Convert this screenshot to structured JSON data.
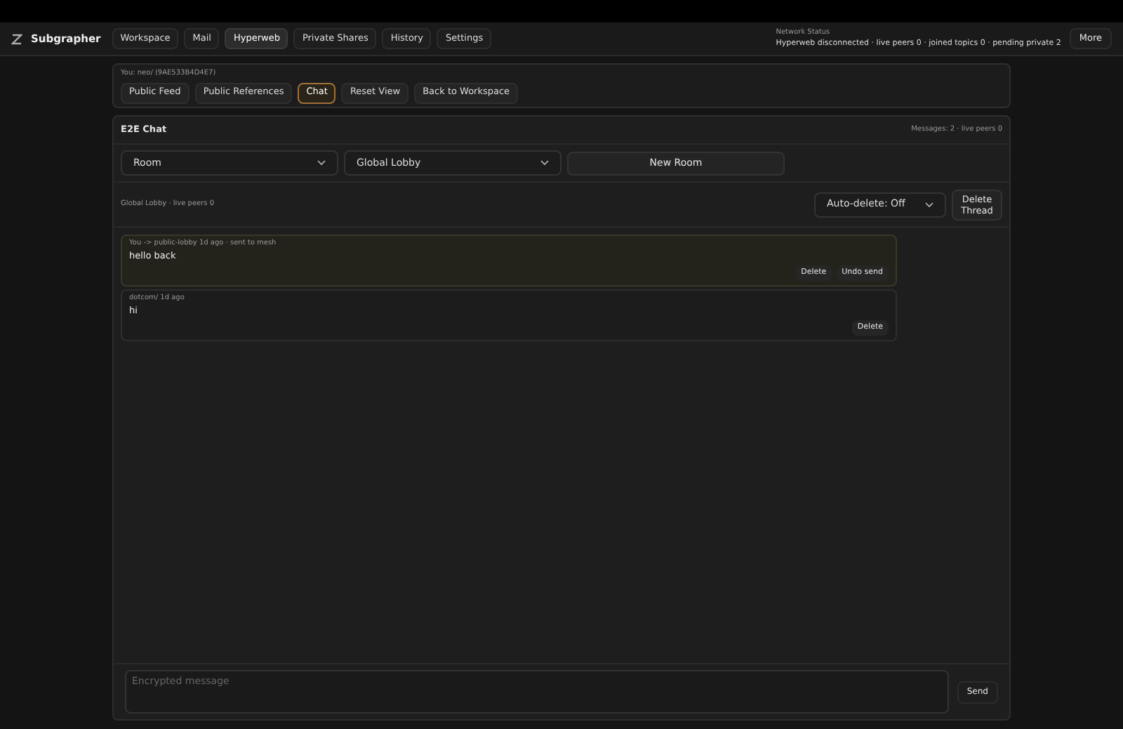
{
  "app": {
    "name": "Subgrapher"
  },
  "nav": [
    {
      "label": "Workspace",
      "selected": false
    },
    {
      "label": "Mail",
      "selected": false
    },
    {
      "label": "Hyperweb",
      "selected": true
    },
    {
      "label": "Private Shares",
      "selected": false
    },
    {
      "label": "History",
      "selected": false
    },
    {
      "label": "Settings",
      "selected": false
    }
  ],
  "network_status": {
    "label": "Network Status",
    "text": "Hyperweb disconnected · live peers 0 · joined topics 0 · pending private 2"
  },
  "more_button": "More",
  "identity": "You: neo/ (9AE533B4D4E7)",
  "tabs": [
    {
      "label": "Public Feed",
      "selected": false
    },
    {
      "label": "Public References",
      "selected": false
    },
    {
      "label": "Chat",
      "selected": true
    },
    {
      "label": "Reset View",
      "selected": false
    },
    {
      "label": "Back to Workspace",
      "selected": false
    }
  ],
  "chat": {
    "title": "E2E Chat",
    "summary": "Messages: 2 · live peers 0",
    "room_type": "Room",
    "room": "Global Lobby",
    "new_room": "New Room",
    "room_status": "Global Lobby · live peers 0",
    "auto_delete": "Auto-delete: Off",
    "delete_thread": "Delete Thread",
    "messages": [
      {
        "meta": "You -> public-lobby 1d ago · sent to mesh",
        "text": "hello back",
        "mine": true,
        "actions": [
          "Delete",
          "Undo send"
        ]
      },
      {
        "meta": "dotcom/ 1d ago",
        "text": "hi",
        "mine": false,
        "actions": [
          "Delete"
        ]
      }
    ],
    "composer": {
      "placeholder": "Encrypted message",
      "send": "Send"
    }
  }
}
